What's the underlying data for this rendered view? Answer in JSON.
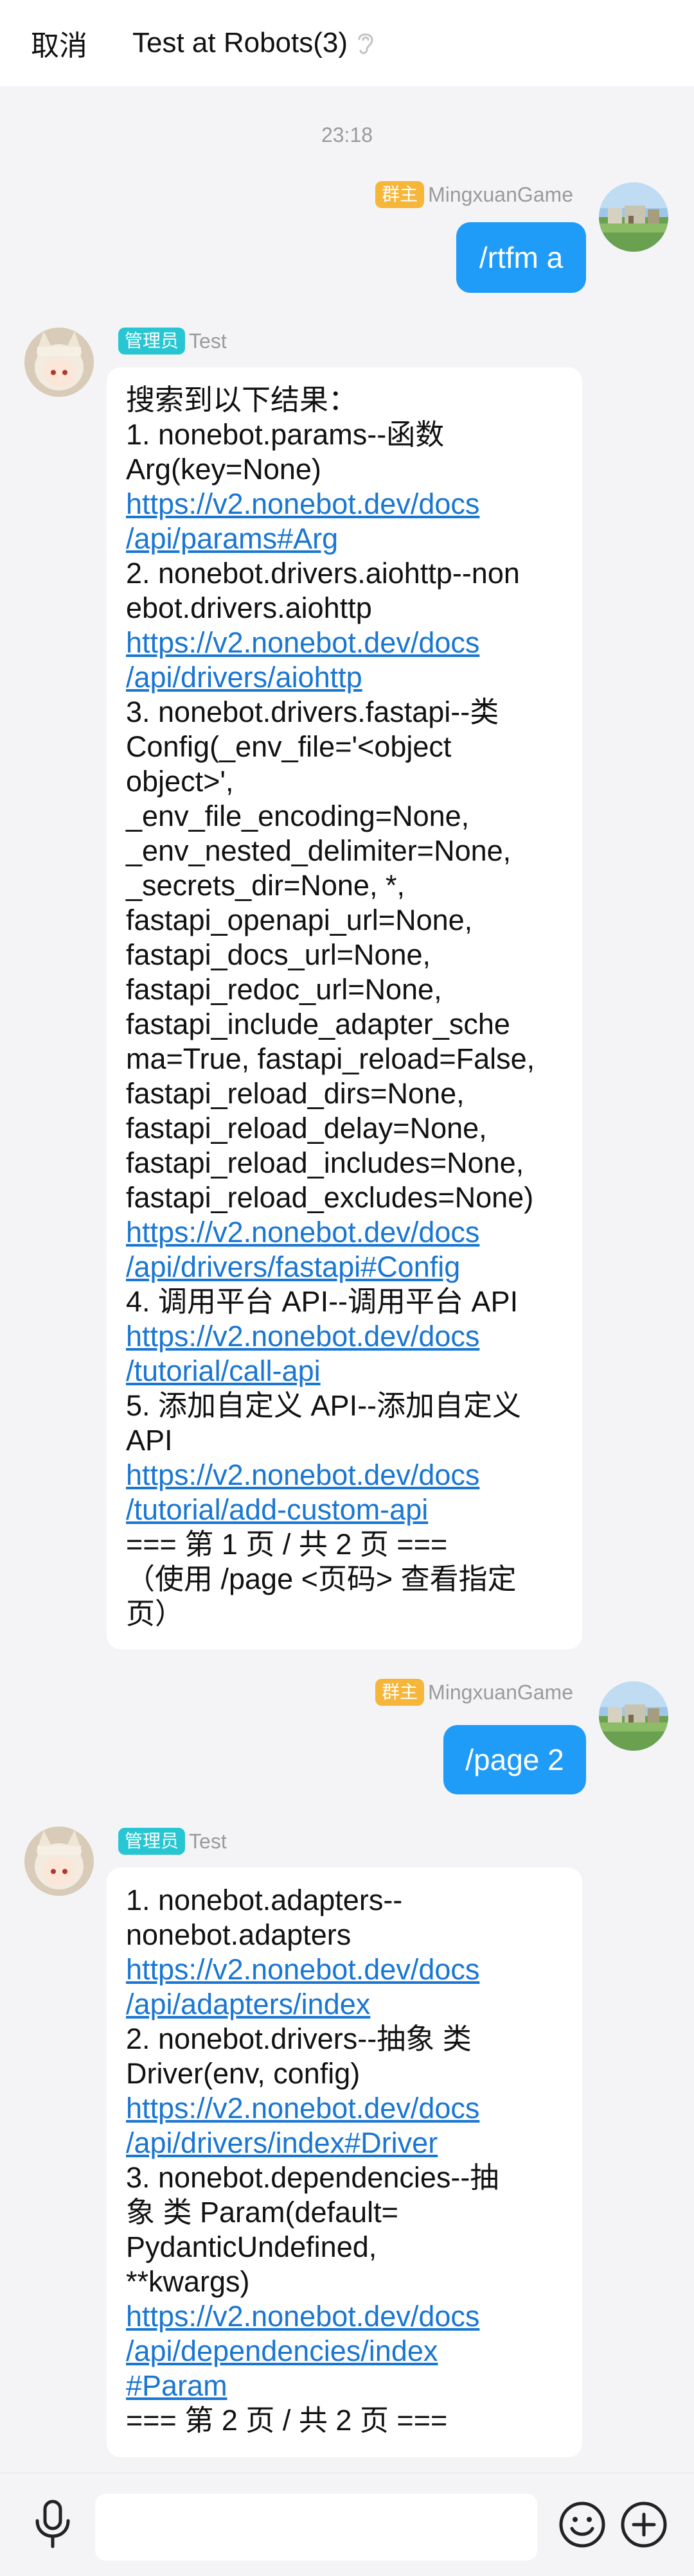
{
  "header": {
    "cancel_label": "取消",
    "title": "Test at Robots(3)"
  },
  "timestamp": "23:18",
  "messages": [
    {
      "direction": "out",
      "badge": "群主",
      "sender": "MingxuanGame",
      "text": "/rtfm a"
    },
    {
      "direction": "in",
      "badge": "管理员",
      "sender": "Test",
      "lines": [
        {
          "t": "text",
          "v": "搜索到以下结果："
        },
        {
          "t": "text",
          "v": "1. nonebot.params--函数"
        },
        {
          "t": "text",
          "v": "Arg(key=None)"
        },
        {
          "t": "link",
          "v": "https://v2.nonebot.dev/docs"
        },
        {
          "t": "link",
          "v": "/api/params#Arg"
        },
        {
          "t": "text",
          "v": "2. nonebot.drivers.aiohttp--non"
        },
        {
          "t": "text",
          "v": "ebot.drivers.aiohttp"
        },
        {
          "t": "link",
          "v": "https://v2.nonebot.dev/docs"
        },
        {
          "t": "link",
          "v": "/api/drivers/aiohttp"
        },
        {
          "t": "text",
          "v": "3. nonebot.drivers.fastapi--类"
        },
        {
          "t": "text",
          "v": "Config(_env_file='<object"
        },
        {
          "t": "text",
          "v": "object>',"
        },
        {
          "t": "text",
          "v": "_env_file_encoding=None,"
        },
        {
          "t": "text",
          "v": "_env_nested_delimiter=None,"
        },
        {
          "t": "text",
          "v": "_secrets_dir=None, *,"
        },
        {
          "t": "text",
          "v": "fastapi_openapi_url=None,"
        },
        {
          "t": "text",
          "v": "fastapi_docs_url=None,"
        },
        {
          "t": "text",
          "v": "fastapi_redoc_url=None,"
        },
        {
          "t": "text",
          "v": "fastapi_include_adapter_sche"
        },
        {
          "t": "text",
          "v": "ma=True, fastapi_reload=False,"
        },
        {
          "t": "text",
          "v": "fastapi_reload_dirs=None,"
        },
        {
          "t": "text",
          "v": "fastapi_reload_delay=None,"
        },
        {
          "t": "text",
          "v": "fastapi_reload_includes=None,"
        },
        {
          "t": "text",
          "v": "fastapi_reload_excludes=None)"
        },
        {
          "t": "link",
          "v": "https://v2.nonebot.dev/docs"
        },
        {
          "t": "link",
          "v": "/api/drivers/fastapi#Config"
        },
        {
          "t": "text",
          "v": "4. 调用平台 API--调用平台 API"
        },
        {
          "t": "link",
          "v": "https://v2.nonebot.dev/docs"
        },
        {
          "t": "link",
          "v": "/tutorial/call-api"
        },
        {
          "t": "text",
          "v": "5. 添加自定义 API--添加自定义"
        },
        {
          "t": "text",
          "v": "API"
        },
        {
          "t": "link",
          "v": "https://v2.nonebot.dev/docs"
        },
        {
          "t": "link",
          "v": "/tutorial/add-custom-api"
        },
        {
          "t": "text",
          "v": "=== 第 1 页 / 共 2 页 ==="
        },
        {
          "t": "text",
          "v": "（使用 /page <页码> 查看指定"
        },
        {
          "t": "text",
          "v": "页）"
        }
      ]
    },
    {
      "direction": "out",
      "badge": "群主",
      "sender": "MingxuanGame",
      "text": "/page 2"
    },
    {
      "direction": "in",
      "badge": "管理员",
      "sender": "Test",
      "lines": [
        {
          "t": "text",
          "v": "1. nonebot.adapters--"
        },
        {
          "t": "text",
          "v": "nonebot.adapters"
        },
        {
          "t": "link",
          "v": "https://v2.nonebot.dev/docs"
        },
        {
          "t": "link",
          "v": "/api/adapters/index"
        },
        {
          "t": "text",
          "v": "2. nonebot.drivers--抽象 类"
        },
        {
          "t": "text",
          "v": "Driver(env, config)"
        },
        {
          "t": "link",
          "v": "https://v2.nonebot.dev/docs"
        },
        {
          "t": "link",
          "v": "/api/drivers/index#Driver"
        },
        {
          "t": "text",
          "v": "3. nonebot.dependencies--抽"
        },
        {
          "t": "text",
          "v": "象 类 Param(default="
        },
        {
          "t": "text",
          "v": "PydanticUndefined,"
        },
        {
          "t": "text",
          "v": "**kwargs)"
        },
        {
          "t": "link",
          "v": "https://v2.nonebot.dev/docs"
        },
        {
          "t": "link",
          "v": "/api/dependencies/index"
        },
        {
          "t": "link",
          "v": "#Param"
        },
        {
          "t": "text",
          "v": "=== 第 2 页 / 共 2 页 ==="
        }
      ]
    }
  ],
  "colors": {
    "bubble_out": "#1f9bf8",
    "link": "#1976d2",
    "badge_owner": "#f5b63a",
    "badge_admin": "#27c6d2"
  },
  "icons": {
    "ear": "ear-icon",
    "mic": "microphone-icon",
    "emoji": "emoji-icon",
    "plus": "plus-icon"
  }
}
